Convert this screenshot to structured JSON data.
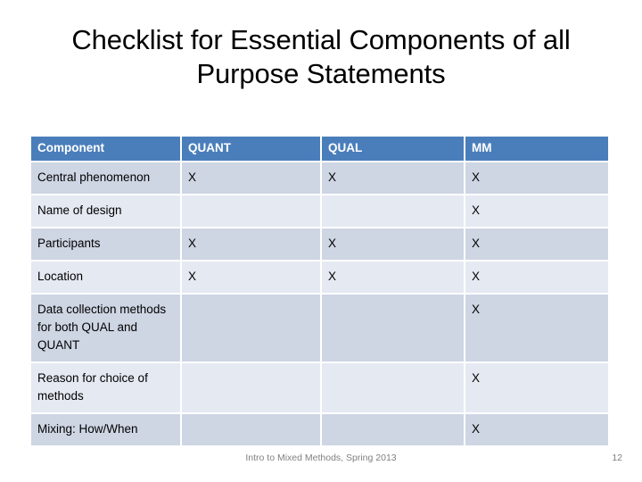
{
  "slide": {
    "title": "Checklist for Essential Components of all Purpose Statements",
    "footer_note": "Intro to Mixed Methods, Spring 2013",
    "page_number": "12"
  },
  "colors": {
    "header_blue": "#4a7ebb",
    "row_dark": "#ced5e3",
    "row_light": "#e5e9f2",
    "footer_gray": "#808080",
    "background": "#ffffff"
  },
  "table": {
    "columns": [
      "Component",
      "QUANT",
      "QUAL",
      "MM"
    ],
    "mark": "X",
    "rows": [
      {
        "component": "Central phenomenon",
        "quant": "X",
        "qual": "X",
        "mm": "X"
      },
      {
        "component": "Name of design",
        "quant": "",
        "qual": "",
        "mm": "X"
      },
      {
        "component": "Participants",
        "quant": "X",
        "qual": "X",
        "mm": "X"
      },
      {
        "component": "Location",
        "quant": "X",
        "qual": "X",
        "mm": "X"
      },
      {
        "component": "Data collection methods for both QUAL and QUANT",
        "quant": "",
        "qual": "",
        "mm": "X"
      },
      {
        "component": "Reason for choice of methods",
        "quant": "",
        "qual": "",
        "mm": "X"
      },
      {
        "component": "Mixing: How/When",
        "quant": "",
        "qual": "",
        "mm": "X"
      }
    ]
  }
}
